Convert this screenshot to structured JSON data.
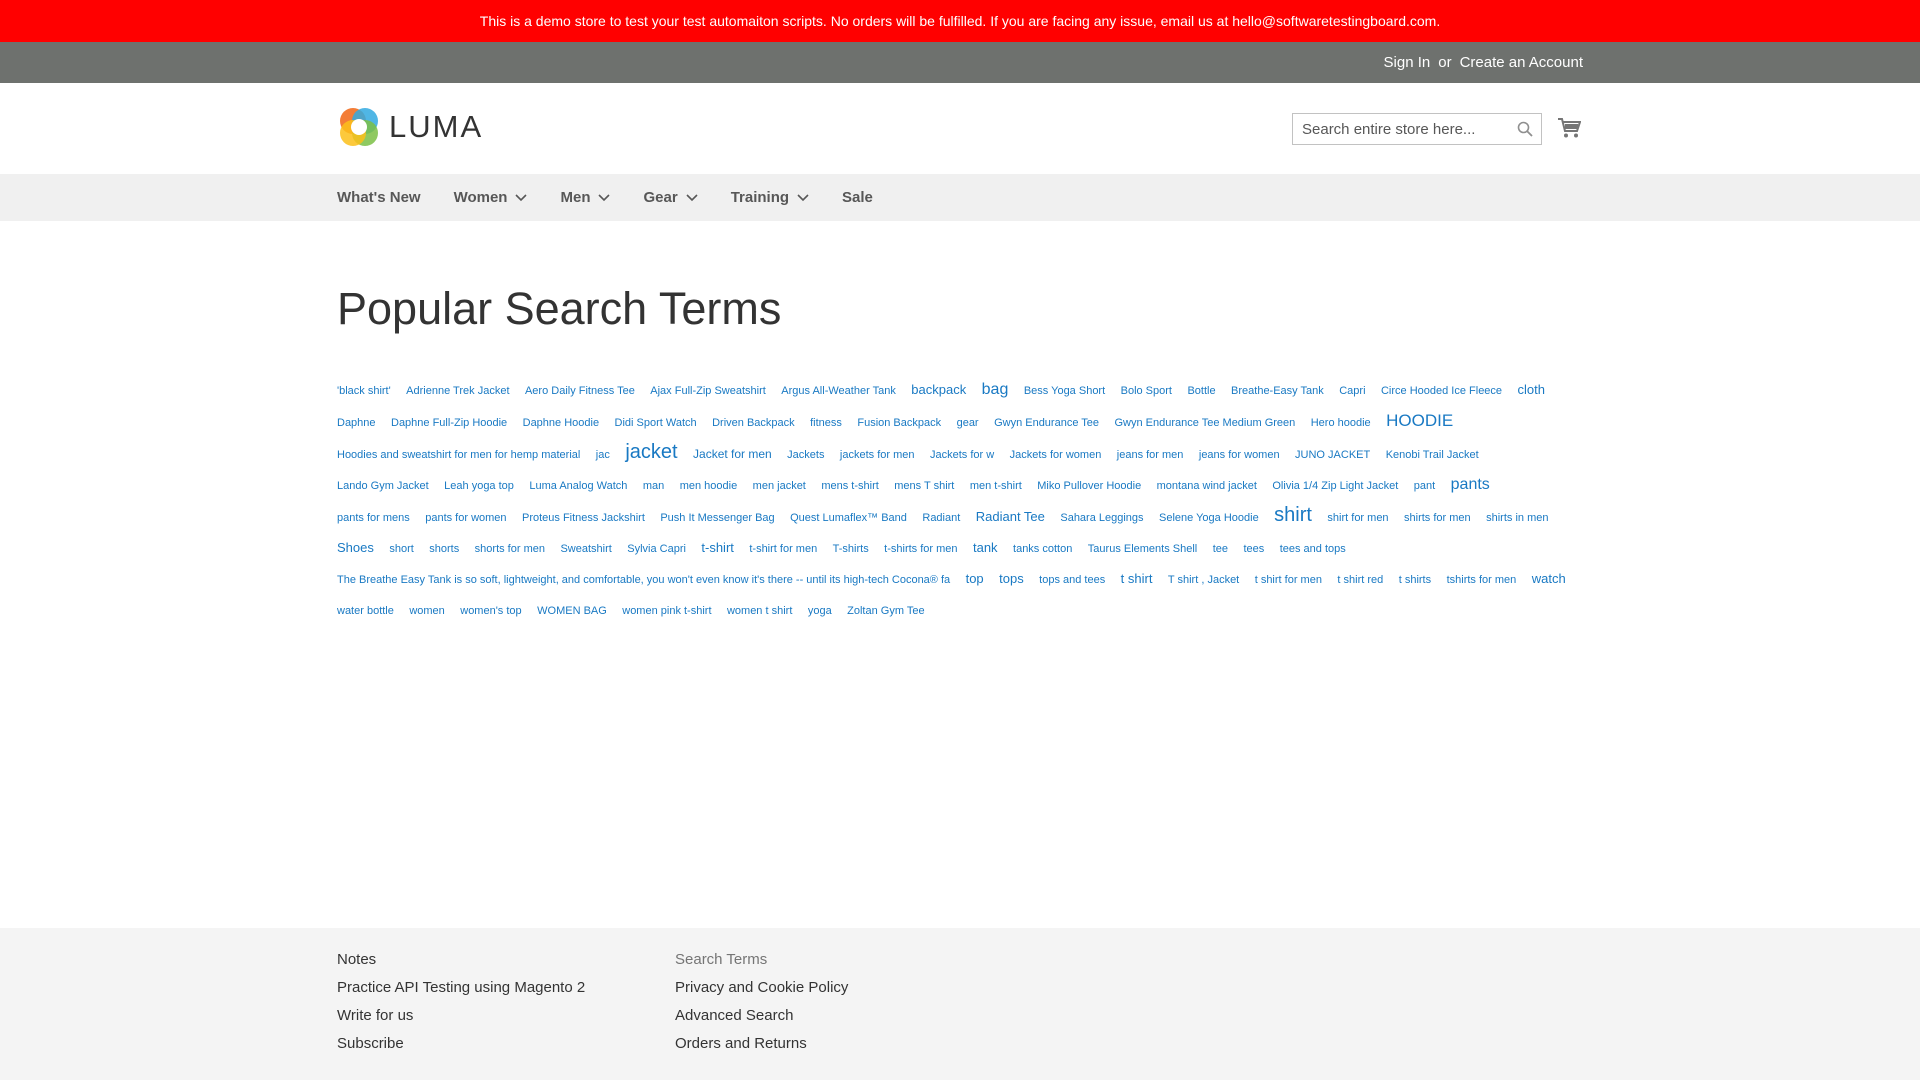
{
  "banner": {
    "text": "This is a demo store to test your test automaiton scripts. No orders will be fulfilled. If you are facing any issue, email us at hello@softwaretestingboard.com."
  },
  "top_links": {
    "sign_in": "Sign In",
    "or": "or",
    "create_account": "Create an Account"
  },
  "header": {
    "logo_text": "LUMA",
    "search_placeholder": "Search entire store here...",
    "icons": [
      "search-icon",
      "cart-icon"
    ]
  },
  "nav": {
    "items": [
      {
        "label": "What's New",
        "has_dropdown": false
      },
      {
        "label": "Women",
        "has_dropdown": true
      },
      {
        "label": "Men",
        "has_dropdown": true
      },
      {
        "label": "Gear",
        "has_dropdown": true
      },
      {
        "label": "Training",
        "has_dropdown": true
      },
      {
        "label": "Sale",
        "has_dropdown": false
      }
    ]
  },
  "main": {
    "title": "Popular Search Terms",
    "terms": [
      {
        "text": "'black shirt'",
        "size": 11
      },
      {
        "text": "Adrienne Trek Jacket",
        "size": 11
      },
      {
        "text": "Aero Daily Fitness Tee",
        "size": 11
      },
      {
        "text": "Ajax Full-Zip Sweatshirt",
        "size": 11
      },
      {
        "text": "Argus All-Weather Tank",
        "size": 11
      },
      {
        "text": "backpack",
        "size": 13
      },
      {
        "text": "bag",
        "size": 16
      },
      {
        "text": "Bess Yoga Short",
        "size": 11
      },
      {
        "text": "Bolo Sport",
        "size": 11
      },
      {
        "text": "Bottle",
        "size": 11
      },
      {
        "text": "Breathe-Easy Tank",
        "size": 11
      },
      {
        "text": "Capri",
        "size": 11
      },
      {
        "text": "Circe Hooded Ice Fleece",
        "size": 11
      },
      {
        "text": "cloth",
        "size": 13
      },
      {
        "text": "Daphne",
        "size": 11
      },
      {
        "text": "Daphne Full-Zip Hoodie",
        "size": 11
      },
      {
        "text": "Daphne Hoodie",
        "size": 11
      },
      {
        "text": "Didi Sport Watch",
        "size": 11
      },
      {
        "text": "Driven Backpack",
        "size": 11
      },
      {
        "text": "fitness",
        "size": 11
      },
      {
        "text": "Fusion Backpack",
        "size": 11
      },
      {
        "text": "gear",
        "size": 11
      },
      {
        "text": "Gwyn Endurance Tee",
        "size": 11
      },
      {
        "text": "Gwyn Endurance Tee Medium Green",
        "size": 11
      },
      {
        "text": "Hero hoodie",
        "size": 11
      },
      {
        "text": "HOODIE",
        "size": 17
      },
      {
        "text": "Hoodies and sweatshirt for men for hemp material",
        "size": 11
      },
      {
        "text": "jac",
        "size": 11
      },
      {
        "text": "jacket",
        "size": 20
      },
      {
        "text": "Jacket for men",
        "size": 12
      },
      {
        "text": "Jackets",
        "size": 11
      },
      {
        "text": "jackets for men",
        "size": 11
      },
      {
        "text": "Jackets for w",
        "size": 11
      },
      {
        "text": "Jackets for women",
        "size": 11
      },
      {
        "text": "jeans for men",
        "size": 11
      },
      {
        "text": "jeans for women",
        "size": 11
      },
      {
        "text": "JUNO JACKET",
        "size": 11
      },
      {
        "text": "Kenobi Trail Jacket",
        "size": 11
      },
      {
        "text": "Lando Gym Jacket",
        "size": 11
      },
      {
        "text": "Leah yoga top",
        "size": 11
      },
      {
        "text": "Luma Analog Watch",
        "size": 11
      },
      {
        "text": "man",
        "size": 11
      },
      {
        "text": "men hoodie",
        "size": 11
      },
      {
        "text": "men jacket",
        "size": 11
      },
      {
        "text": "mens t-shirt",
        "size": 11
      },
      {
        "text": "mens T shirt",
        "size": 11
      },
      {
        "text": "men t-shirt",
        "size": 11
      },
      {
        "text": "Miko Pullover Hoodie",
        "size": 11
      },
      {
        "text": "montana wind jacket",
        "size": 11
      },
      {
        "text": "Olivia 1/4 Zip Light Jacket",
        "size": 11
      },
      {
        "text": "pant",
        "size": 11
      },
      {
        "text": "pants",
        "size": 16
      },
      {
        "text": "pants for mens",
        "size": 11
      },
      {
        "text": "pants for women",
        "size": 11
      },
      {
        "text": "Proteus Fitness Jackshirt",
        "size": 11
      },
      {
        "text": "Push It Messenger Bag",
        "size": 11
      },
      {
        "text": "Quest Lumaflex™ Band",
        "size": 11
      },
      {
        "text": "Radiant",
        "size": 11
      },
      {
        "text": "Radiant Tee",
        "size": 13
      },
      {
        "text": "Sahara Leggings",
        "size": 11
      },
      {
        "text": "Selene Yoga Hoodie",
        "size": 11
      },
      {
        "text": "shirt",
        "size": 20
      },
      {
        "text": "shirt for men",
        "size": 11
      },
      {
        "text": "shirts for men",
        "size": 11
      },
      {
        "text": "shirts in men",
        "size": 11
      },
      {
        "text": "Shoes",
        "size": 13
      },
      {
        "text": "short",
        "size": 11
      },
      {
        "text": "shorts",
        "size": 11
      },
      {
        "text": "shorts for men",
        "size": 11
      },
      {
        "text": "Sweatshirt",
        "size": 11
      },
      {
        "text": "Sylvia Capri",
        "size": 11
      },
      {
        "text": "t-shirt",
        "size": 13
      },
      {
        "text": "t-shirt for men",
        "size": 11
      },
      {
        "text": "T-shirts",
        "size": 11
      },
      {
        "text": "t-shirts for men",
        "size": 11
      },
      {
        "text": "tank",
        "size": 13
      },
      {
        "text": "tanks cotton",
        "size": 11
      },
      {
        "text": "Taurus Elements Shell",
        "size": 11
      },
      {
        "text": "tee",
        "size": 11
      },
      {
        "text": "tees",
        "size": 11
      },
      {
        "text": "tees and tops",
        "size": 11
      },
      {
        "text": "The Breathe Easy Tank is so soft, lightweight, and comfortable, you won't even know it's there -- until its high-tech Cocona® fa",
        "size": 11
      },
      {
        "text": "top",
        "size": 13
      },
      {
        "text": "tops",
        "size": 13
      },
      {
        "text": "tops and tees",
        "size": 11
      },
      {
        "text": "t shirt",
        "size": 13
      },
      {
        "text": "T shirt , Jacket",
        "size": 11
      },
      {
        "text": "t shirt for men",
        "size": 11
      },
      {
        "text": "t shirt red",
        "size": 11
      },
      {
        "text": "t shirts",
        "size": 11
      },
      {
        "text": "tshirts for men",
        "size": 11
      },
      {
        "text": "watch",
        "size": 13
      },
      {
        "text": "water bottle",
        "size": 11
      },
      {
        "text": "women",
        "size": 11
      },
      {
        "text": "women's top",
        "size": 11
      },
      {
        "text": "WOMEN BAG",
        "size": 11
      },
      {
        "text": "women pink t-shirt",
        "size": 11
      },
      {
        "text": "women t shirt",
        "size": 11
      },
      {
        "text": "yoga",
        "size": 11
      },
      {
        "text": "Zoltan Gym Tee",
        "size": 11
      }
    ]
  },
  "footer": {
    "col1": [
      "Notes",
      "Practice API Testing using Magento 2",
      "Write for us",
      "Subscribe"
    ],
    "col2": [
      "Search Terms",
      "Privacy and Cookie Policy",
      "Advanced Search",
      "Orders and Returns"
    ]
  },
  "colors": {
    "banner_bg": "#ff0000",
    "topbar_bg": "#6e716e",
    "nav_bg": "#f0f0f0",
    "link": "#1979c3",
    "footer_bg": "#f4f4f4"
  }
}
